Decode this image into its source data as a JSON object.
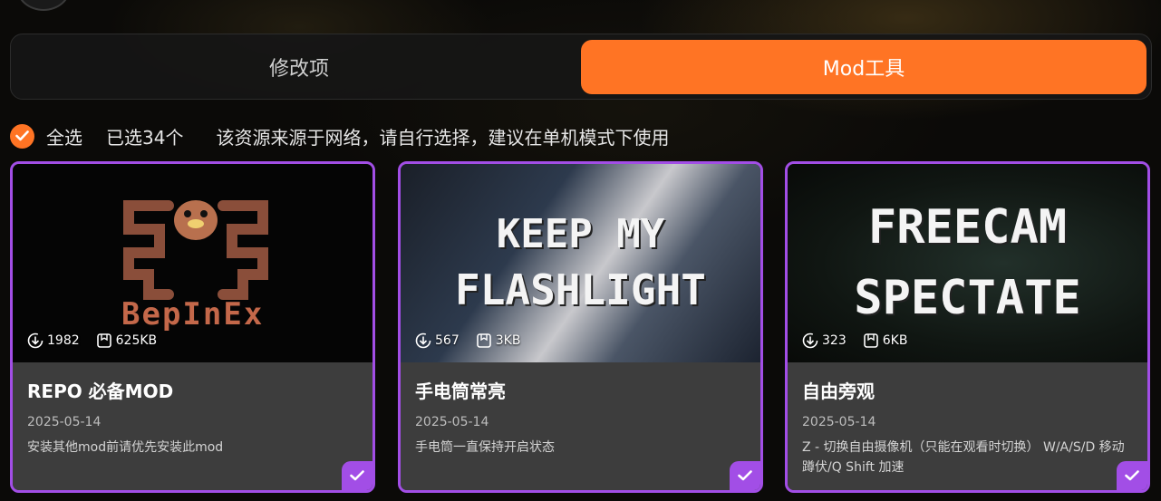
{
  "tabs": [
    {
      "label": "修改项",
      "active": false
    },
    {
      "label": "Mod工具",
      "active": true
    }
  ],
  "selection": {
    "select_all_label": "全选",
    "selected_count": "已选34个",
    "notice": "该资源来源于网络，请自行选择，建议在单机模式下使用"
  },
  "cards": [
    {
      "image_text": "BepInEx",
      "downloads": "1982",
      "size": "625KB",
      "title": "REPO 必备MOD",
      "date": "2025-05-14",
      "desc": "安装其他mod前请优先安装此mod",
      "checked": true
    },
    {
      "image_text_line1": "KEEP MY",
      "image_text_line2": "FLASHLIGHT",
      "downloads": "567",
      "size": "3KB",
      "title": "手电筒常亮",
      "date": "2025-05-14",
      "desc": "手电筒一直保持开启状态",
      "checked": true
    },
    {
      "image_text_line1": "FREECAM",
      "image_text_line2": "SPECTATE",
      "downloads": "323",
      "size": "6KB",
      "title": "自由旁观",
      "date": "2025-05-14",
      "desc": "Z - 切换自由摄像机（只能在观看时切换） W/A/S/D 移动 蹲伏/Q Shift 加速",
      "checked": true
    }
  ],
  "colors": {
    "accent": "#ff7424",
    "selected_border": "#a24ee6",
    "card_body": "#3d3d3d"
  }
}
